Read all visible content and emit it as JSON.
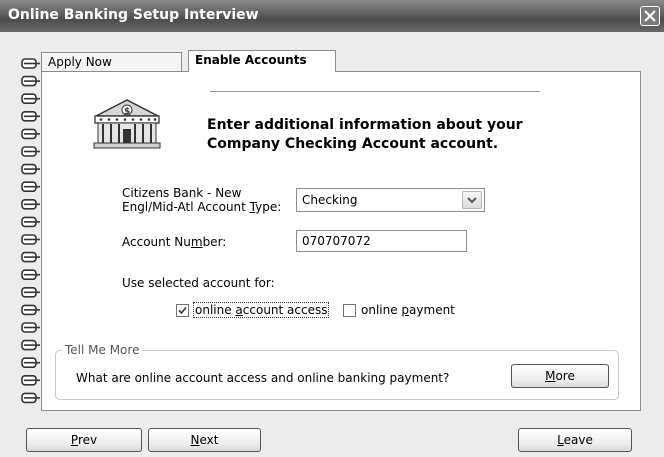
{
  "window": {
    "title": "Online Banking Setup Interview",
    "close_icon": "close-icon"
  },
  "tabs": [
    {
      "label": "Apply Now",
      "active": false
    },
    {
      "label": "Enable Accounts",
      "active": true
    }
  ],
  "heading": {
    "line1": "Enter additional information about your",
    "line2": "Company Checking Account account."
  },
  "account_type": {
    "label_line1": "Citizens Bank - New",
    "label_line2_pre": "Engl/Mid-Atl Account ",
    "label_line2_u": "T",
    "label_line2_post": "ype:",
    "value": "Checking"
  },
  "account_number": {
    "label_pre": "Account Nu",
    "label_u": "m",
    "label_post": "ber:",
    "value": "070707072"
  },
  "use_for": {
    "label": "Use selected account for:",
    "online_access": {
      "label_pre": "online ",
      "label_u": "a",
      "label_post": "ccount access",
      "checked": true
    },
    "online_payment": {
      "label_pre": "online ",
      "label_u": "p",
      "label_post": "ayment",
      "checked": false
    }
  },
  "tell_me_more": {
    "title": "Tell Me More",
    "question": "What are online account access and online banking payment?",
    "button_u": "M",
    "button_post": "ore"
  },
  "footer": {
    "prev_u": "P",
    "prev_post": "rev",
    "next_u": "N",
    "next_post": "ext",
    "leave_u": "L",
    "leave_post": "eave"
  },
  "colors": {
    "title_bar": "#5e5e5e",
    "page_bg": "#ffffff",
    "frame_bg": "#ececec"
  }
}
